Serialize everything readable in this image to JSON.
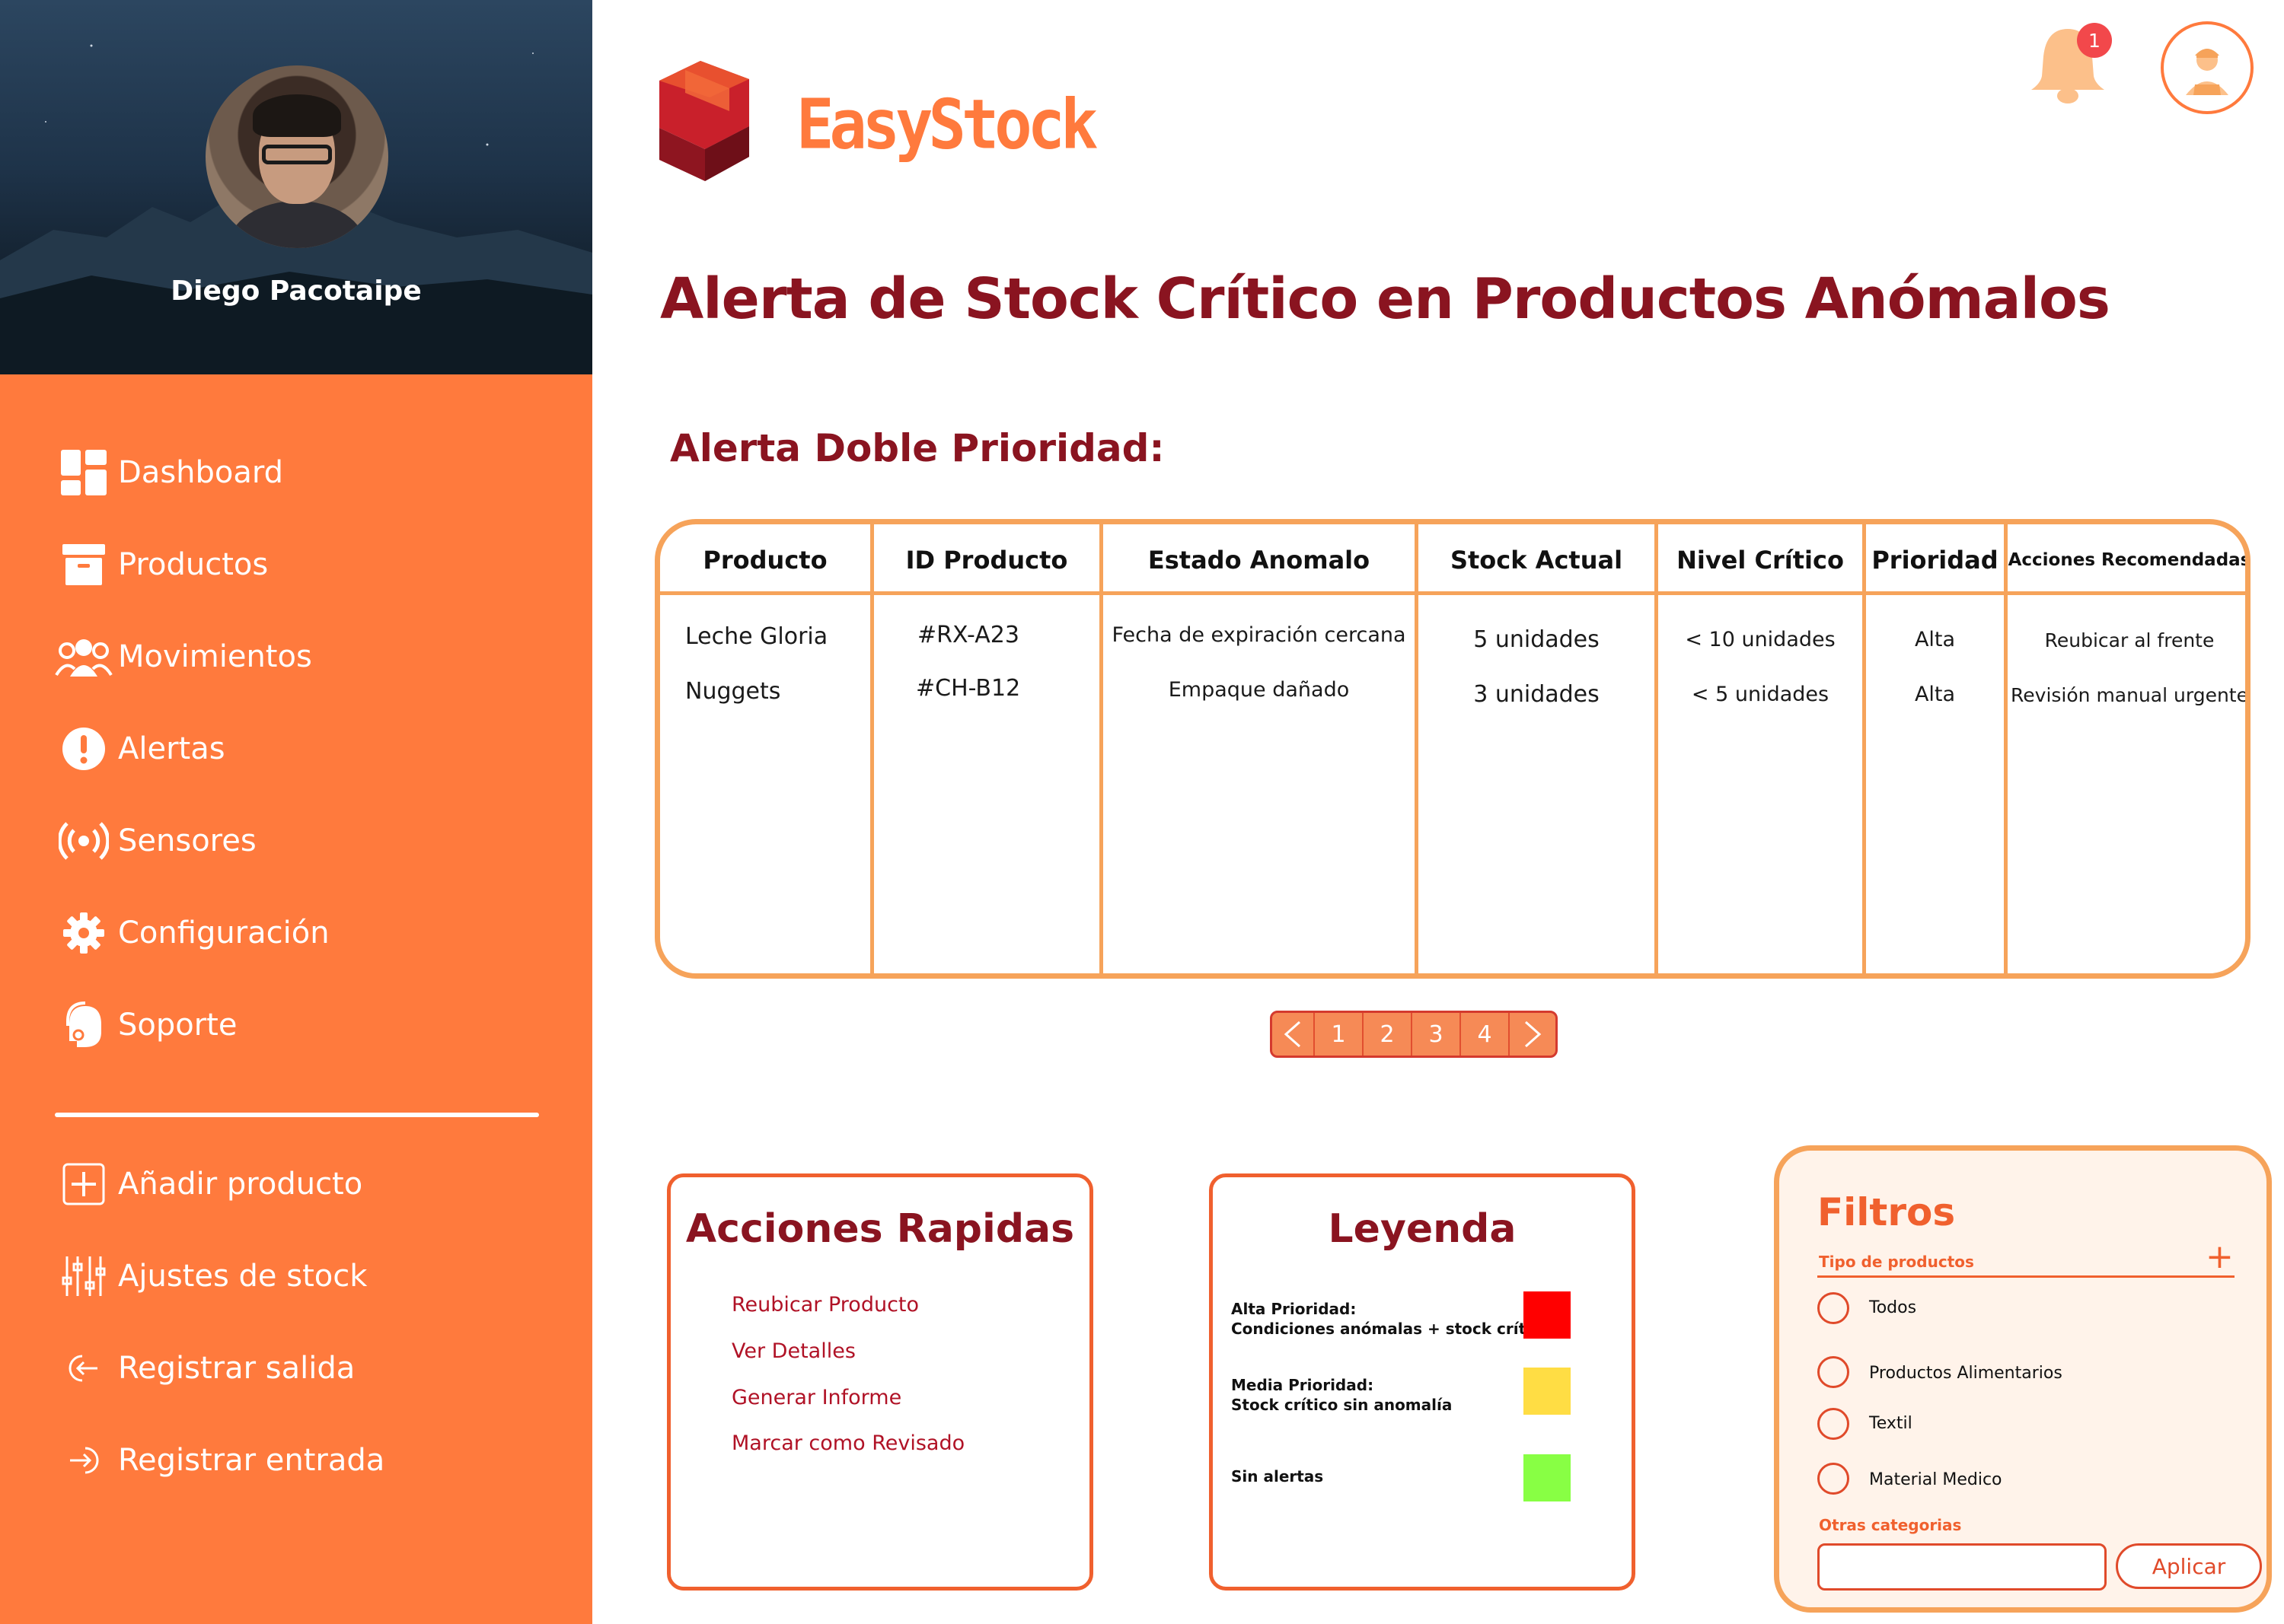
{
  "user": {
    "name": "Diego Pacotaipe"
  },
  "brand": {
    "name": "EasyStock"
  },
  "header": {
    "notification_count": "1"
  },
  "sidebar": {
    "items": [
      {
        "label": "Dashboard",
        "icon": "dashboard-icon"
      },
      {
        "label": "Productos",
        "icon": "archive-box-icon"
      },
      {
        "label": "Movimientos",
        "icon": "users-icon"
      },
      {
        "label": "Alertas",
        "icon": "alert-circle-icon"
      },
      {
        "label": "Sensores",
        "icon": "broadcast-icon"
      },
      {
        "label": "Configuración",
        "icon": "gear-icon"
      },
      {
        "label": "Soporte",
        "icon": "support-agent-icon"
      }
    ],
    "actions": [
      {
        "label": "Añadir producto",
        "icon": "plus-square-icon"
      },
      {
        "label": "Ajustes de stock",
        "icon": "sliders-icon"
      },
      {
        "label": "Registrar salida",
        "icon": "logout-icon"
      },
      {
        "label": "Registrar entrada",
        "icon": "login-icon"
      }
    ]
  },
  "page": {
    "title": "Alerta de Stock Crítico en Productos Anómalos",
    "section_title": "Alerta Doble Prioridad:"
  },
  "table": {
    "headers": [
      "Producto",
      "ID Producto",
      "Estado Anomalo",
      "Stock Actual",
      "Nivel Crítico",
      "Prioridad",
      "Acciones Recomendadas"
    ],
    "rows": [
      [
        "Leche Gloria",
        "#RX-A23",
        "Fecha de expiración cercana",
        "5 unidades",
        "< 10 unidades",
        "Alta",
        "Reubicar al frente"
      ],
      [
        "Nuggets",
        "#CH-B12",
        "Empaque dañado",
        "3 unidades",
        "< 5 unidades",
        "Alta",
        "Revisión manual urgente"
      ]
    ]
  },
  "pagination": {
    "prev": "<",
    "pages": [
      "1",
      "2",
      "3",
      "4"
    ],
    "next": ">"
  },
  "quick_actions": {
    "title": "Acciones Rapidas",
    "items": [
      "Reubicar Producto",
      "Ver Detalles",
      "Generar Informe",
      "Marcar como Revisado"
    ]
  },
  "legend": {
    "title": "Leyenda",
    "items": [
      {
        "line1": "Alta Prioridad:",
        "line2": "Condiciones anómalas + stock crítico",
        "color": "#FF0000"
      },
      {
        "line1": "Media Prioridad:",
        "line2": "Stock crítico sin anomalía",
        "color": "#FFDD44"
      },
      {
        "line1": "Sin alertas",
        "line2": "",
        "color": "#88FF44"
      }
    ]
  },
  "filters": {
    "title": "Filtros",
    "type_label": "Tipo de productos",
    "options": [
      "Todos",
      "Productos Alimentarios",
      "Textil",
      "Material Medico"
    ],
    "other_label": "Otras categorias",
    "other_value": "",
    "apply_label": "Aplicar"
  },
  "colors": {
    "accent": "#FF7A3D",
    "title": "#8A1420",
    "table_border": "#F6A35A",
    "link": "#B01226"
  }
}
